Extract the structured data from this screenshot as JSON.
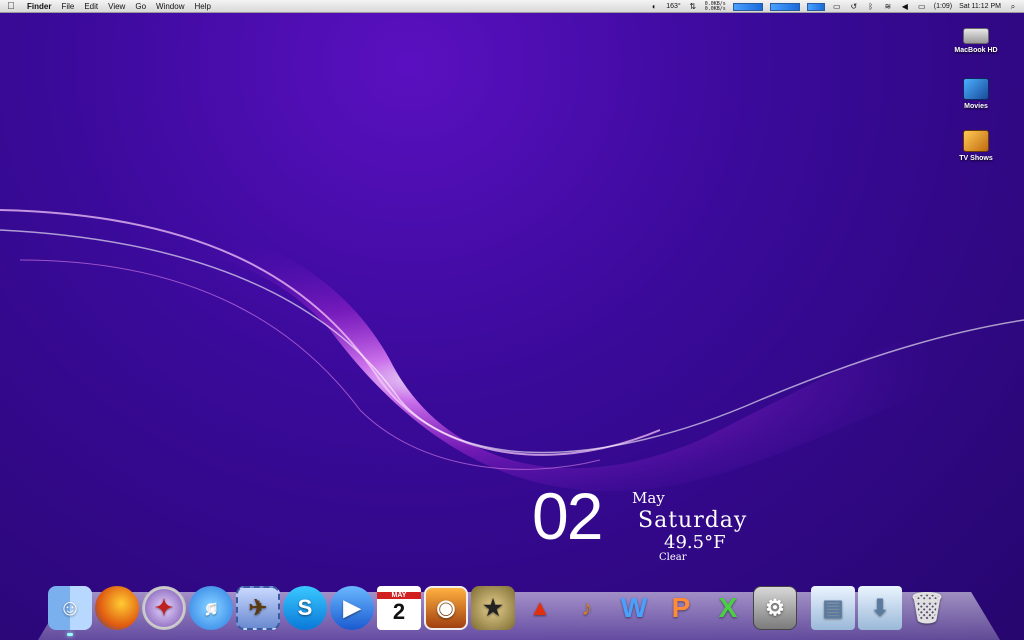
{
  "menubar": {
    "app_name": "Finder",
    "menus": [
      "File",
      "Edit",
      "View",
      "Go",
      "Window",
      "Help"
    ],
    "temperature": "163°",
    "net_up": "0.0KB/s",
    "net_down": "0.0KB/s",
    "battery": "(1:09)",
    "clock": "Sat 11:12 PM"
  },
  "desktop": {
    "icons": [
      {
        "label": "MacBook HD"
      },
      {
        "label": "Movies"
      },
      {
        "label": "TV Shows"
      }
    ]
  },
  "widget": {
    "day": "02",
    "month": "May",
    "weekday": "Saturday",
    "temperature": "49.5°F",
    "condition": "Clear"
  },
  "dock": {
    "calendar_day": "2",
    "calendar_month": "MAY"
  }
}
